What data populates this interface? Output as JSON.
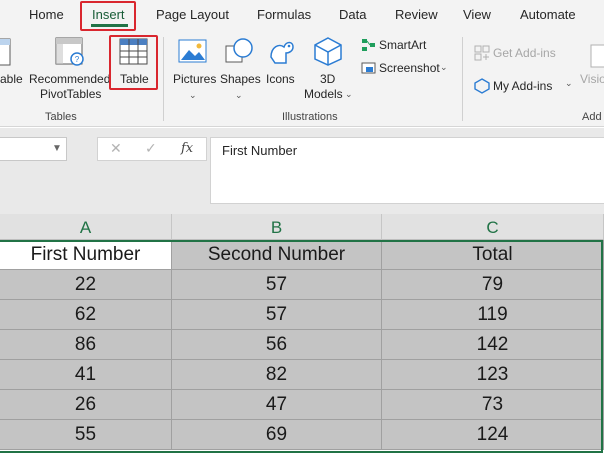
{
  "ribbon_tabs": [
    "Home",
    "Insert",
    "Page Layout",
    "Formulas",
    "Data",
    "Review",
    "View",
    "Automate"
  ],
  "active_tab": "Insert",
  "ribbon": {
    "table_cut": "able",
    "recommended_line1": "Recommended",
    "recommended_line2": "PivotTables",
    "table_label": "Table",
    "tables_group": "Tables",
    "pictures": "Pictures",
    "shapes": "Shapes",
    "icons": "Icons",
    "models_line1": "3D",
    "models_line2": "Models",
    "smartart": "SmartArt",
    "screenshot": "Screenshot",
    "illustrations_group": "Illustrations",
    "get_addins": "Get Add-ins",
    "my_addins": "My Add-ins",
    "visio_cut": "Visio",
    "addins_group_cut": "Add"
  },
  "formula_bar": {
    "namebox_value": "",
    "fx_symbol": "fx",
    "formula": "First Number"
  },
  "columns": [
    "A",
    "B",
    "C"
  ],
  "table": {
    "headers": [
      "First Number",
      "Second Number",
      "Total"
    ],
    "rows": [
      [
        "22",
        "57",
        "79"
      ],
      [
        "62",
        "57",
        "119"
      ],
      [
        "86",
        "56",
        "142"
      ],
      [
        "41",
        "82",
        "123"
      ],
      [
        "26",
        "47",
        "73"
      ],
      [
        "55",
        "69",
        "124"
      ]
    ]
  },
  "colors": {
    "accent_green": "#217346",
    "highlight_red": "#d9262e",
    "selection_gray": "#c4c4c4"
  }
}
